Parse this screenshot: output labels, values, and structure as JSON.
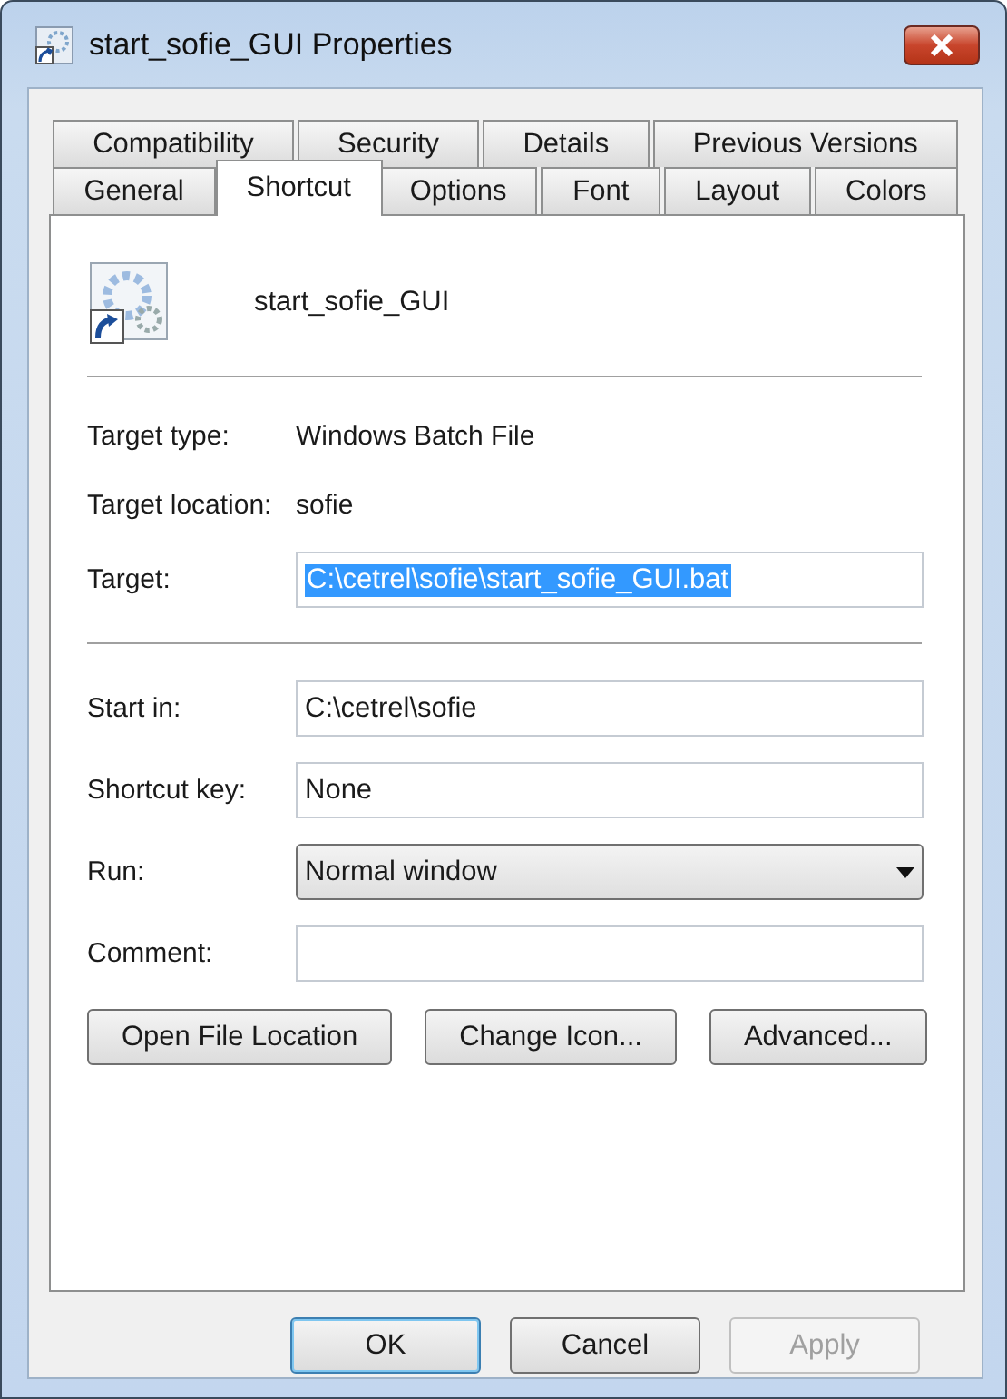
{
  "window": {
    "title": "start_sofie_GUI Properties"
  },
  "tab_rows": [
    [
      {
        "label": "Compatibility",
        "selected": false
      },
      {
        "label": "Security",
        "selected": false
      },
      {
        "label": "Details",
        "selected": false
      },
      {
        "label": "Previous Versions",
        "selected": false
      }
    ],
    [
      {
        "label": "General",
        "selected": false
      },
      {
        "label": "Shortcut",
        "selected": true
      },
      {
        "label": "Options",
        "selected": false
      },
      {
        "label": "Font",
        "selected": false
      },
      {
        "label": "Layout",
        "selected": false
      },
      {
        "label": "Colors",
        "selected": false
      }
    ]
  ],
  "shortcut": {
    "name": "start_sofie_GUI"
  },
  "info": [
    {
      "label": "Target type:",
      "value": "Windows Batch File"
    },
    {
      "label": "Target location:",
      "value": "sofie"
    }
  ],
  "target": {
    "label": "Target:",
    "value": "C:\\cetrel\\sofie\\start_sofie_GUI.bat",
    "highlighted": true
  },
  "fields": [
    {
      "kind": "text",
      "label": "Start in:",
      "value": "C:\\cetrel\\sofie"
    },
    {
      "kind": "text",
      "label": "Shortcut key:",
      "value": "None"
    },
    {
      "kind": "dropdown",
      "label": "Run:",
      "value": "Normal window"
    },
    {
      "kind": "text",
      "label": "Comment:"
    }
  ],
  "actions": [
    "Open File Location",
    "Change Icon...",
    "Advanced..."
  ],
  "dialog_buttons": [
    {
      "label": "OK",
      "default": true,
      "disabled": false
    },
    {
      "label": "Cancel",
      "default": false,
      "disabled": false
    },
    {
      "label": "Apply",
      "default": false,
      "disabled": true
    }
  ]
}
